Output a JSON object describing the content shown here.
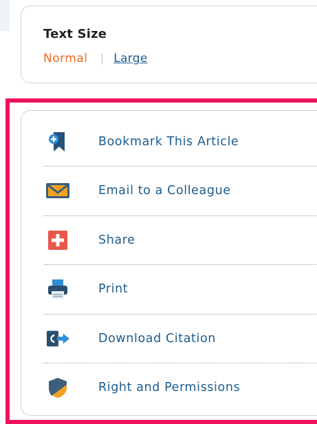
{
  "text_size": {
    "title": "Text Size",
    "normal_label": "Normal",
    "separator": "|",
    "large_label": "Large"
  },
  "tools": {
    "items": [
      {
        "label": "Bookmark This Article",
        "icon": "bookmark-icon"
      },
      {
        "label": "Email to a Colleague",
        "icon": "email-icon"
      },
      {
        "label": "Share",
        "icon": "share-icon"
      },
      {
        "label": "Print",
        "icon": "print-icon"
      },
      {
        "label": "Download Citation",
        "icon": "download-citation-icon"
      },
      {
        "label": "Right and Permissions",
        "icon": "permissions-shield-icon"
      }
    ]
  },
  "colors": {
    "highlight": "#f0115e",
    "link": "#1d5c8e",
    "selected": "#f06a1e"
  }
}
